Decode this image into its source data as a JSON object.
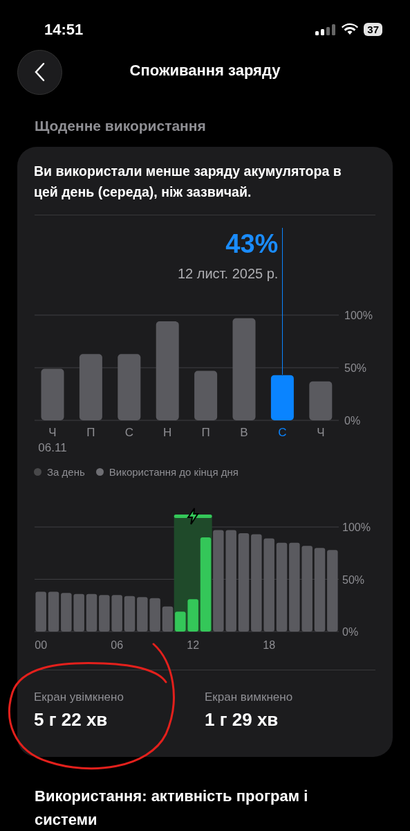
{
  "status_bar": {
    "time": "14:51",
    "battery": "37"
  },
  "header": {
    "title": "Споживання заряду"
  },
  "section_title": "Щоденне використання",
  "daily_usage": {
    "summary": "Ви використали менше заряду акумулятора в цей день (середа), ніж зазвичай.",
    "callout": {
      "value": "43%",
      "date": "12 лист. 2025 р."
    },
    "first_date": "06.11",
    "selected_bars": [
      false,
      false,
      false,
      false,
      false,
      false,
      true,
      false
    ],
    "chart_data": {
      "type": "bar",
      "categories": [
        "Ч",
        "П",
        "С",
        "Н",
        "П",
        "В",
        "С",
        "Ч"
      ],
      "ylim": [
        0,
        100
      ],
      "yticks": [
        {
          "value": 0,
          "label": "0%"
        },
        {
          "value": 50,
          "label": "50%"
        },
        {
          "value": 100,
          "label": "100%"
        }
      ],
      "ref_lines": [
        {
          "axis": "y",
          "value": 50,
          "color": "#3f3f42"
        }
      ],
      "series": [
        {
          "color": "#5a5a5f",
          "values": [
            49,
            63,
            63,
            94,
            47,
            97,
            null,
            37
          ]
        },
        {
          "color": "#0a84ff",
          "values": [
            null,
            null,
            null,
            null,
            null,
            null,
            43,
            null
          ]
        }
      ]
    }
  },
  "legend": [
    {
      "label": "За день",
      "color": "#48484a"
    },
    {
      "label": "Використання до кінця дня",
      "color": "#6e6e73"
    }
  ],
  "hourly_level": {
    "chart_data": {
      "type": "bar",
      "x": [
        0,
        1,
        2,
        3,
        4,
        5,
        6,
        7,
        8,
        9,
        10,
        11,
        12,
        13,
        14,
        15,
        16,
        17,
        18,
        19,
        20,
        21,
        22,
        23
      ],
      "xlim": [
        -0.5,
        23.5
      ],
      "bands": [
        {
          "axis": "x",
          "from": 10.5,
          "to": 13.5,
          "color": "#1f4a2a"
        }
      ],
      "xticks": [
        {
          "value": 0,
          "label": "00"
        },
        {
          "value": 6,
          "label": "06"
        },
        {
          "value": 12,
          "label": "12"
        },
        {
          "value": 18,
          "label": "18"
        }
      ],
      "ylim": [
        0,
        100
      ],
      "yticks": [
        {
          "value": 0,
          "label": "0%"
        },
        {
          "value": 50,
          "label": "50%"
        },
        {
          "value": 100,
          "label": "100%"
        }
      ],
      "series": [
        {
          "color": "#5a5a5f",
          "values": [
            38,
            38,
            37,
            36,
            36,
            35,
            35,
            34,
            33,
            32,
            24,
            null,
            null,
            null,
            97,
            97,
            94,
            93,
            89,
            85,
            85,
            82,
            80,
            78
          ]
        },
        {
          "color": "#34c759",
          "values": [
            null,
            null,
            null,
            null,
            null,
            null,
            null,
            null,
            null,
            null,
            null,
            19,
            31,
            90,
            null,
            null,
            null,
            null,
            null,
            null,
            null,
            null,
            null,
            null
          ]
        }
      ]
    }
  },
  "screen_stats": [
    {
      "label": "Екран увімкнено",
      "value": "5 г 22 хв"
    },
    {
      "label": "Екран вимкнено",
      "value": "1 г 29 хв"
    }
  ],
  "next_section_title": "Використання: активність програм і системи",
  "annotation": {
    "kind": "circle"
  }
}
